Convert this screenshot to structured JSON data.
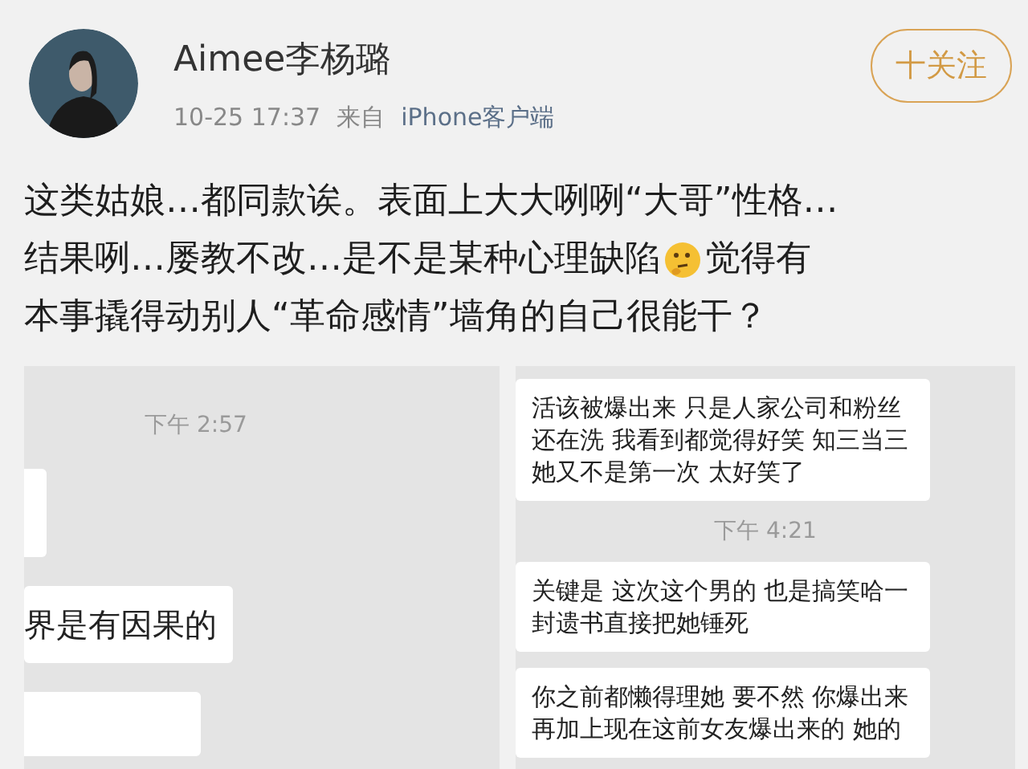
{
  "post": {
    "author": "Aimee李杨璐",
    "time": "10-25 17:37",
    "source_prefix": "来自",
    "source": "iPhone客户端",
    "follow_button": "十关注",
    "lines": [
      [
        {
          "kind": "text",
          "text": "这类姑娘…都同款诶。表面上大大咧咧“大哥”性格…"
        }
      ],
      [
        {
          "kind": "text",
          "text": "结果咧…屡教不改…是不是某种心理缺陷"
        },
        {
          "kind": "emoji"
        },
        {
          "kind": "text",
          "text": "觉得有"
        }
      ],
      [
        {
          "kind": "text",
          "text": "本事撬得动别人“革命感情”墙角的自己很能干？"
        }
      ]
    ]
  },
  "images": [
    {
      "messages": [
        {
          "kind": "time",
          "text": "下午 2:57"
        },
        {
          "kind": "stub"
        },
        {
          "kind": "bubble",
          "text": "界是有因果的"
        },
        {
          "kind": "stub"
        }
      ]
    },
    {
      "messages": [
        {
          "kind": "bubble",
          "text": "活该被爆出来 只是人家公司和粉丝还在洗 我看到都觉得好笑 知三当三她又不是第一次 太好笑了"
        },
        {
          "kind": "time",
          "text": "下午 4:21"
        },
        {
          "kind": "bubble",
          "text": "关键是 这次这个男的 也是搞笑哈一封遗书直接把她锤死"
        },
        {
          "kind": "bubble",
          "text": "你之前都懒得理她 要不然 你爆出来再加上现在这前女友爆出来的 她的"
        }
      ]
    }
  ]
}
